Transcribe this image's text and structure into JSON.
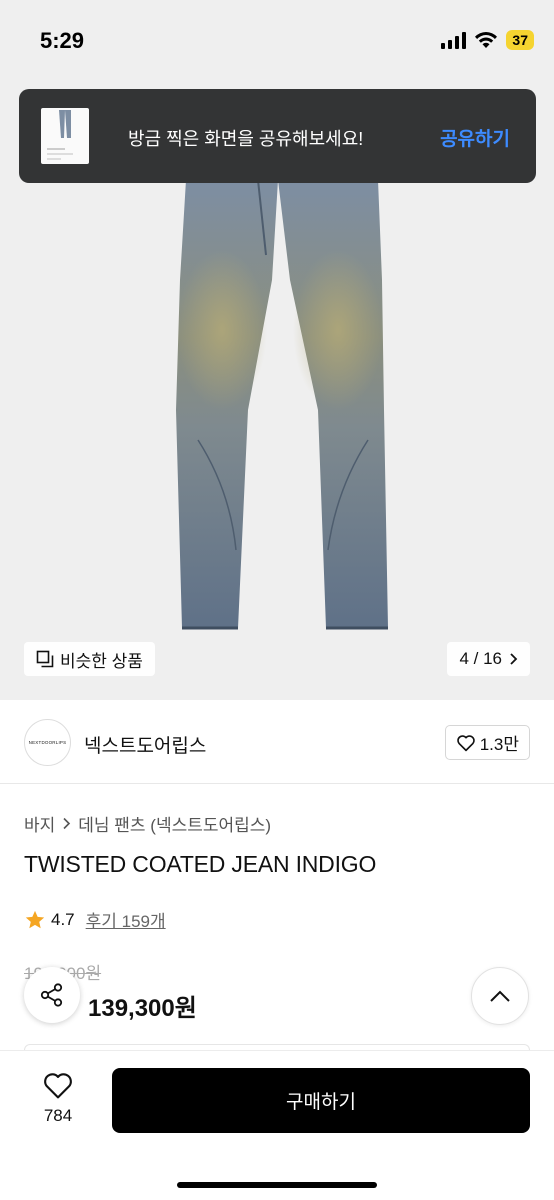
{
  "status_bar": {
    "time": "5:29",
    "battery": "37"
  },
  "toast": {
    "message": "방금 찍은 화면을 공유해보세요!",
    "action": "공유하기"
  },
  "gallery": {
    "similar_label": "비슷한 상품",
    "counter": "4 / 16"
  },
  "brand": {
    "logo_text": "NEXTDOORLIPS",
    "name": "넥스트도어립스",
    "likes": "1.3만"
  },
  "breadcrumb": {
    "category": "바지",
    "subcategory": "데님 팬츠 (넥스트도어립스)"
  },
  "product": {
    "title": "TWISTED COATED JEAN INDIGO",
    "rating": "4.7",
    "reviews": "후기 159개",
    "original_price": "199,000원",
    "sale_price": "139,300원"
  },
  "bottom_bar": {
    "wish_count": "784",
    "buy_label": "구매하기"
  },
  "colors": {
    "accent_link": "#3d8bff",
    "star": "#f5a623",
    "discount": "#e12b2b",
    "buy_button": "#000000"
  }
}
